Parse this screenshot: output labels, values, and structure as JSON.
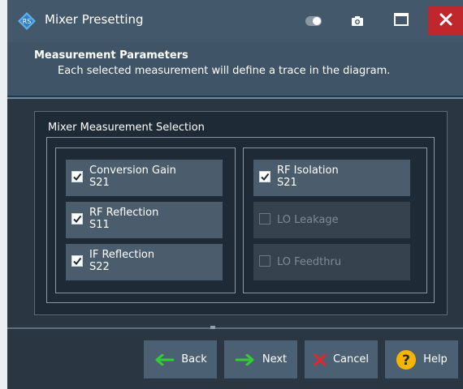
{
  "window": {
    "title": "Mixer Presetting",
    "icons": {
      "app": "rs-logo-icon",
      "toggle": "toggle-icon",
      "screenshot": "camera-icon",
      "maximize": "maximize-icon",
      "close": "close-icon"
    }
  },
  "header": {
    "title": "Measurement Parameters",
    "subtitle": "Each selected measurement will define a trace in the diagram."
  },
  "group": {
    "label": "Mixer Measurement Selection",
    "left": [
      {
        "name": "Conversion Gain",
        "param": "S21",
        "checked": true,
        "enabled": true
      },
      {
        "name": "RF Reflection",
        "param": "S11",
        "checked": true,
        "enabled": true
      },
      {
        "name": "IF Reflection",
        "param": "S22",
        "checked": true,
        "enabled": true
      }
    ],
    "right": [
      {
        "name": "RF Isolation",
        "param": "S21",
        "checked": true,
        "enabled": true
      },
      {
        "name": "LO Leakage",
        "param": "",
        "checked": false,
        "enabled": false
      },
      {
        "name": "LO Feedthru",
        "param": "",
        "checked": false,
        "enabled": false
      }
    ]
  },
  "buttons": {
    "back": "Back",
    "next": "Next",
    "cancel": "Cancel",
    "help": "Help"
  },
  "colors": {
    "accent_green": "#32cd32",
    "cancel_red": "#e8232a",
    "help_yellow": "#f5b400",
    "close_red": "#c0272d"
  }
}
